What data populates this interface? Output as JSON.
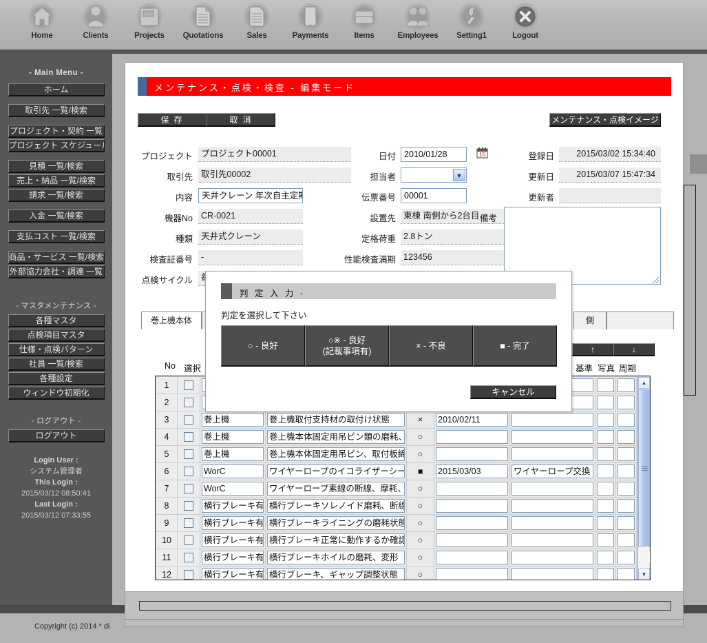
{
  "topnav": [
    {
      "label": "Home",
      "icon": "home-icon"
    },
    {
      "label": "Clients",
      "icon": "person-icon"
    },
    {
      "label": "Projects",
      "icon": "folder-icon"
    },
    {
      "label": "Quotations",
      "icon": "document-icon"
    },
    {
      "label": "Sales",
      "icon": "document-lines-icon"
    },
    {
      "label": "Payments",
      "icon": "receipt-icon"
    },
    {
      "label": "Items",
      "icon": "briefcase-icon"
    },
    {
      "label": "Employees",
      "icon": "people-icon"
    },
    {
      "label": "Setting1",
      "icon": "wrench-icon"
    },
    {
      "label": "Logout",
      "icon": "close-x-icon"
    }
  ],
  "sidebar": {
    "main_menu_header": "- Main Menu -",
    "master_header": "- マスタメンテナンス -",
    "logout_header": "- ログアウト -",
    "groups": [
      [
        "ホーム"
      ],
      [
        "取引先 一覧/検索"
      ],
      [
        "プロジェクト・契約 一覧",
        "プロジェクト スケジュール"
      ],
      [
        "見積 一覧/検索",
        "売上・納品 一覧/検索",
        "請求 一覧/検索"
      ],
      [
        "入金 一覧/検索"
      ],
      [
        "支払コスト 一覧/検索"
      ],
      [
        "商品・サービス 一覧/検索",
        "外部協力会社・調達 一覧"
      ]
    ],
    "master_items": [
      "各種マスタ",
      "点検項目マスタ",
      "仕様・点検パターン",
      "社員 一覧/検索",
      "各種設定",
      "ウィンドウ初期化"
    ],
    "logout_items": [
      "ログアウト"
    ],
    "login": {
      "user_key": "Login User :",
      "user_value": "システム管理者",
      "this_key": "This Login :",
      "this_value": "2015/03/12 08:50:41",
      "last_key": "Last Login :",
      "last_value": "2015/03/12 07:33:55"
    }
  },
  "page": {
    "title": "メンテナンス・点検・検査 - 編集モード",
    "title_bg": "#ff0000",
    "buttons": {
      "save": "保 存",
      "cancel": "取 消",
      "image": "メンテナンス・点検イメージ"
    }
  },
  "form": {
    "col1": [
      {
        "label": "プロジェクト",
        "value": "プロジェクト00001",
        "type": "readonly"
      },
      {
        "label": "取引先",
        "value": "取引先00002",
        "type": "readonly"
      },
      {
        "label": "内容",
        "value": "天井クレーン 年次自主定期検査",
        "type": "input"
      },
      {
        "label": "機器No",
        "value": "CR-0021",
        "type": "readonly"
      },
      {
        "label": "種類",
        "value": "天井式クレーン",
        "type": "readonly"
      },
      {
        "label": "検査証番号",
        "value": "-",
        "type": "readonly"
      },
      {
        "label": "点検サイクル",
        "value": "毎",
        "type": "readonly"
      }
    ],
    "col2": [
      {
        "label": "日付",
        "value": "2010/01/28",
        "type": "input"
      },
      {
        "label": "担当者",
        "value": "",
        "type": "select"
      },
      {
        "label": "伝票番号",
        "value": "00001",
        "type": "input"
      },
      {
        "label": "設置先",
        "value": "東棟 南側から2台目",
        "type": "readonly"
      },
      {
        "label": "定格荷重",
        "value": "2.8トン",
        "type": "readonly"
      },
      {
        "label": "性能検査満期",
        "value": "123456",
        "type": "readonly"
      }
    ],
    "col3": [
      {
        "label": "登録日",
        "value": "2015/03/02 15:34:40",
        "type": "readonly"
      },
      {
        "label": "更新日",
        "value": "2015/03/07 15:47:34",
        "type": "readonly"
      },
      {
        "label": "更新者",
        "value": "",
        "type": "readonly"
      }
    ],
    "memo_label": "備考",
    "memo_value": "",
    "calendar_icon": "calendar-icon"
  },
  "tabs": [
    {
      "label": "巻上機本体",
      "active": true
    },
    {
      "label": "",
      "active": false
    },
    {
      "label": "",
      "active": false
    },
    {
      "label": "",
      "active": false
    },
    {
      "label": "側",
      "active": false
    },
    {
      "label": "",
      "active": false
    }
  ],
  "table": {
    "move_up": "↑",
    "move_down": "↓",
    "headers_left": [
      "No",
      "選択"
    ],
    "headers_right": [
      "基準",
      "写真",
      "周期"
    ],
    "rows": [
      {
        "no": "1",
        "kind": "",
        "item": "",
        "result": "",
        "date": "",
        "note": ""
      },
      {
        "no": "2",
        "kind": "",
        "item": "",
        "result": "",
        "date": "",
        "note": ""
      },
      {
        "no": "3",
        "kind": "巻上機",
        "item": "巻上機取付支持材の取付け状態",
        "result": "×",
        "date": "2010/02/11",
        "note": ""
      },
      {
        "no": "4",
        "kind": "巻上機",
        "item": "巻上機本体固定用吊ピン類の磨耗、",
        "result": "○",
        "date": "",
        "note": ""
      },
      {
        "no": "5",
        "kind": "巻上機",
        "item": "巻上機本体固定用吊ピン、取付板締",
        "result": "○",
        "date": "",
        "note": ""
      },
      {
        "no": "6",
        "kind": "WorC",
        "item": "ワイヤーロープのイコライザーシーブ",
        "result": "■",
        "date": "2015/03/03",
        "note": "ワイヤーロープ交換"
      },
      {
        "no": "7",
        "kind": "WorC",
        "item": "ワイヤーロープ素線の断線、摩耗、キ",
        "result": "○",
        "date": "",
        "note": ""
      },
      {
        "no": "8",
        "kind": "横行ブレーキ有無",
        "item": "横行ブレーキソレノイド磨耗、断線、損",
        "result": "○",
        "date": "",
        "note": ""
      },
      {
        "no": "9",
        "kind": "横行ブレーキ有無",
        "item": "横行ブレーキライニングの磨耗状態",
        "result": "○",
        "date": "",
        "note": ""
      },
      {
        "no": "10",
        "kind": "横行ブレーキ有無",
        "item": "横行ブレーキ正常に動作するか確認",
        "result": "○",
        "date": "",
        "note": ""
      },
      {
        "no": "11",
        "kind": "横行ブレーキ有無",
        "item": "横行ブレーキホイルの磨耗、変形",
        "result": "○",
        "date": "",
        "note": ""
      },
      {
        "no": "12",
        "kind": "横行ブレーキ有無",
        "item": "横行ブレーキ、ギャップ調整状態",
        "result": "○",
        "date": "",
        "note": ""
      }
    ]
  },
  "modal": {
    "title": "判 定 入 力 -",
    "prompt": "判定を選択して下さい",
    "choices": [
      {
        "lines": [
          "○ - 良好"
        ]
      },
      {
        "lines": [
          "○※ - 良好",
          "(記載事項有)"
        ]
      },
      {
        "lines": [
          "× - 不良"
        ]
      },
      {
        "lines": [
          "■ - 完了"
        ]
      }
    ],
    "cancel": "キャンセル"
  },
  "footer": {
    "copyright": "Copyright (c) 2014 * di"
  }
}
